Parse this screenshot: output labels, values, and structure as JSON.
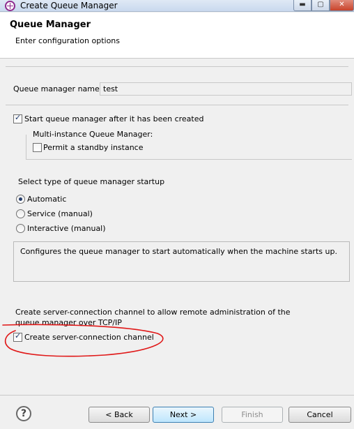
{
  "window": {
    "title": "Create Queue Manager",
    "minimize_glyph": "▬",
    "maximize_glyph": "▢",
    "close_glyph": "✕"
  },
  "header": {
    "title": "Queue Manager",
    "description": "Enter configuration options"
  },
  "form": {
    "qm_name_label": "Queue manager name:",
    "qm_name_value": "test",
    "start_after_create_label": "Start queue manager after it has been created",
    "start_after_create_checked": true,
    "multi_instance_label": "Multi-instance Queue Manager:",
    "permit_standby_label": "Permit a standby instance",
    "permit_standby_checked": false,
    "startup_type_label": "Select type of queue manager startup",
    "startup_options": [
      "Automatic",
      "Service (manual)",
      "Interactive (manual)"
    ],
    "startup_selected": "Automatic",
    "startup_description": "Configures the queue manager to start automatically when the machine starts up.",
    "server_conn_info_line1": "Create server-connection channel to allow remote administration of the",
    "server_conn_info_line2": "queue manager over TCP/IP",
    "server_conn_label": "Create server-connection channel",
    "server_conn_checked": true
  },
  "footer": {
    "help_glyph": "?",
    "back_label": "< Back",
    "next_label": "Next >",
    "finish_label": "Finish",
    "cancel_label": "Cancel"
  },
  "colors": {
    "annotation_stroke": "#e01818",
    "app_icon": "#8e2a8e"
  },
  "icons": {
    "app": "queue-manager-app-icon",
    "help": "help-icon"
  }
}
